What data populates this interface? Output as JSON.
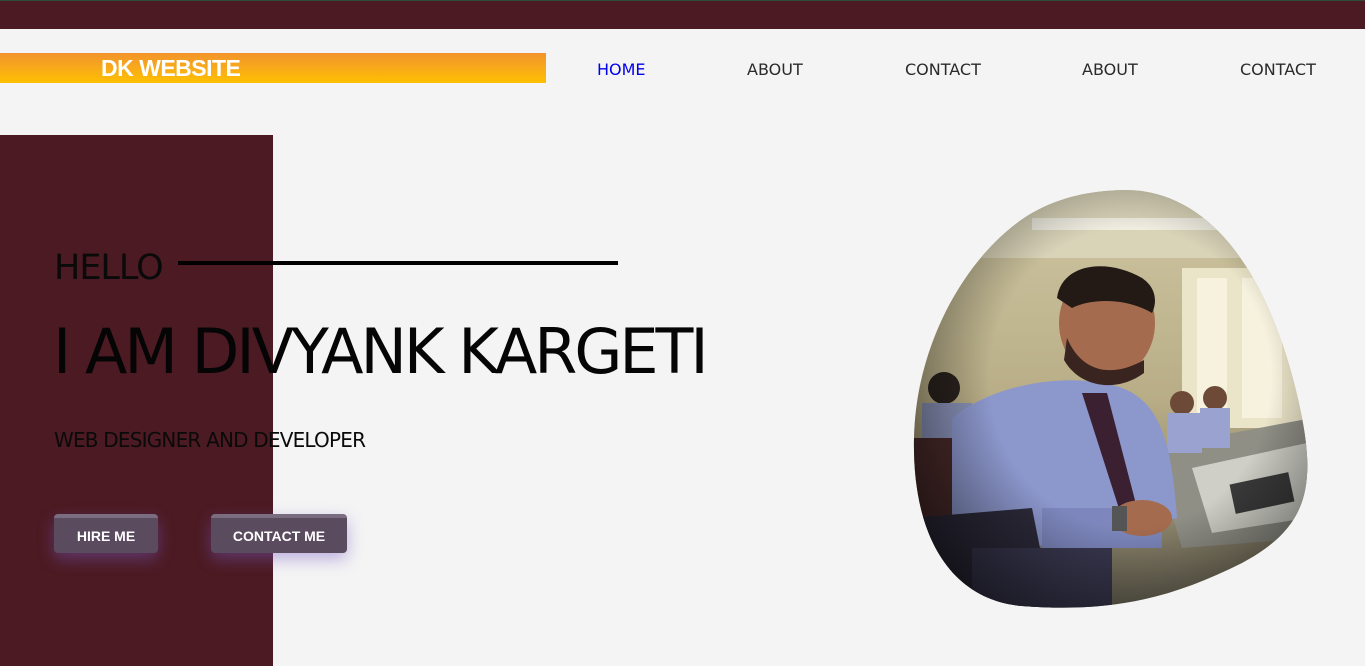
{
  "header": {
    "brand": "DK WEBSITE",
    "nav": [
      {
        "label": "HOME",
        "active": true
      },
      {
        "label": "ABOUT",
        "active": false
      },
      {
        "label": "CONTACT",
        "active": false
      },
      {
        "label": "ABOUT",
        "active": false
      },
      {
        "label": "CONTACT",
        "active": false
      }
    ]
  },
  "hero": {
    "greeting": "HELLO",
    "name": "I AM DIVYANK KARGETI",
    "tagline": "WEB DESIGNER AND DEVELOPER",
    "hire_label": "HIRE ME",
    "contact_label": "CONTACT ME"
  },
  "colors": {
    "topbar": "#4c1a22",
    "accent_block": "#4c1a22",
    "brand_gradient_start": "#f2932a",
    "brand_gradient_end": "#ffc000",
    "nav_active": "#0000ee",
    "button_bg": "#5a4b5f"
  }
}
